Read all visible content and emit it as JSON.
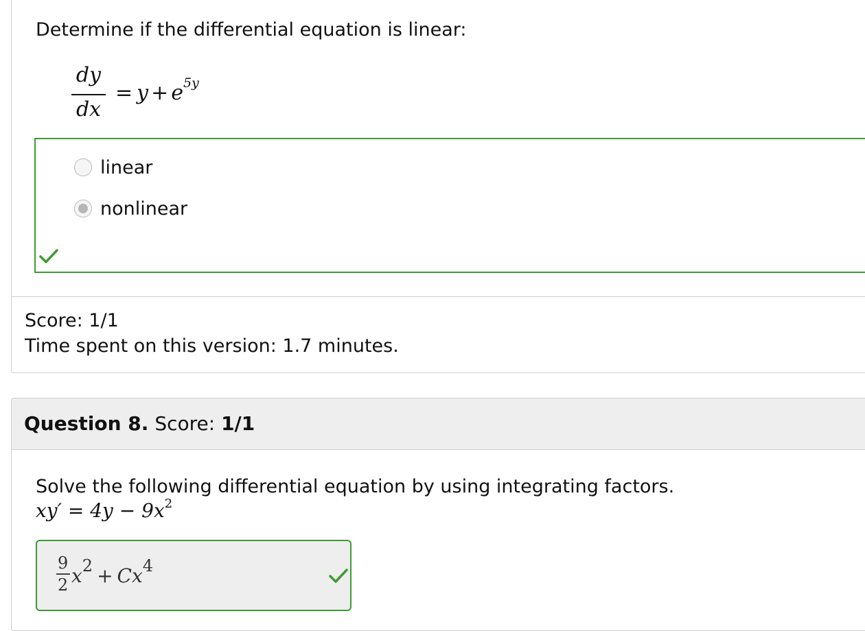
{
  "question7": {
    "prompt": "Determine if the differential equation is linear:",
    "equation": {
      "numerator": "dy",
      "denominator": "dx",
      "equals": "=",
      "term1": "y",
      "plus": "+",
      "base": "e",
      "exponent": "5y"
    },
    "options": [
      {
        "label": "linear",
        "selected": false
      },
      {
        "label": "nonlinear",
        "selected": true
      }
    ],
    "status_icon": "check-icon",
    "score_text": "Score: 1/1",
    "time_text": "Time spent on this version: 1.7 minutes."
  },
  "question8": {
    "title_bold": "Question 8.",
    "score_label": " Score: ",
    "score_value": "1/1",
    "prompt": "Solve the following differential equation by using integrating factors.",
    "equation": {
      "lhs": "xy′",
      "equals": " = ",
      "term1": "4y",
      "minus": " − ",
      "term2": "9x",
      "exp": "2"
    },
    "answer": {
      "frac_num": "9",
      "frac_den": "2",
      "var1": "x",
      "exp1": "2",
      "op": "+",
      "var2": "Cx",
      "exp2": "4"
    },
    "status_icon": "check-icon"
  },
  "colors": {
    "correct": "#3c9b31",
    "border": "#cfcfcf",
    "header_bg": "#eeeeee"
  }
}
